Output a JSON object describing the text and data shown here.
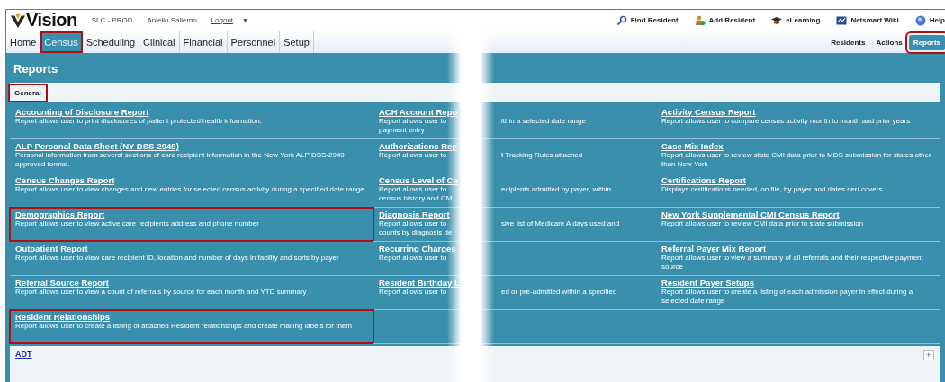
{
  "header": {
    "logo": "Vision",
    "environment": "SLC - PROD",
    "user": "Aniello Saliemo",
    "logout": "Logout",
    "menu_caret": "▼",
    "links": [
      {
        "kind": "search",
        "label": "Find Resident"
      },
      {
        "kind": "add",
        "label": "Add Resident"
      },
      {
        "kind": "cap",
        "label": "eLearning"
      },
      {
        "kind": "wiki",
        "label": "Netsmart Wiki"
      },
      {
        "kind": "help",
        "label": "Help"
      }
    ]
  },
  "tabs": [
    {
      "label": "Home",
      "selected": false,
      "highlighted": false
    },
    {
      "label": "Census",
      "selected": true,
      "highlighted": true
    },
    {
      "label": "Scheduling",
      "selected": false,
      "highlighted": false
    },
    {
      "label": "Clinical",
      "selected": false,
      "highlighted": false
    },
    {
      "label": "Financial",
      "selected": false,
      "highlighted": false
    },
    {
      "label": "Personnel",
      "selected": false,
      "highlighted": false
    },
    {
      "label": "Setup",
      "selected": false,
      "highlighted": false
    }
  ],
  "subtabs": [
    {
      "label": "Residents",
      "selected": false,
      "highlighted": false
    },
    {
      "label": "Actions",
      "selected": false,
      "highlighted": false
    },
    {
      "label": "Reports",
      "selected": true,
      "highlighted": true
    }
  ],
  "page_title": "Reports",
  "section": {
    "label": "General",
    "highlighted": true
  },
  "columns": [
    [
      {
        "title": "Accounting of Disclosure Report",
        "description": "Report allows user to print disclosures of patient protected health information.",
        "highlighted": false
      },
      {
        "title": "ALP Personal Data Sheet (NY DSS-2949)",
        "description": "Personal information from several sections of care recipient information in the New York ALP DSS-2949 approved format.",
        "highlighted": false
      },
      {
        "title": "Census Changes Report",
        "description": "Report allows user to view changes and new entries for selected census activity during a specified date range",
        "highlighted": false
      },
      {
        "title": "Demographics Report",
        "description": "Report allows user to view active care recipients address and phone number",
        "highlighted": true
      },
      {
        "title": "Outpatient Report",
        "description": "Report allows user to view care recipient ID, location and number of days in facility and sorts by payer",
        "highlighted": false
      },
      {
        "title": "Referral Source Report",
        "description": "Report allows user to view a count of referrals by source for each month and YTD summary",
        "highlighted": false
      },
      {
        "title": "Resident Relationships",
        "description": "Report allows user to create a listing of attached Resident relationships and create mailing labels for them",
        "highlighted": true
      }
    ],
    [
      {
        "title": "ACH Account Repo",
        "lines": [
          [
            "Report allows user to",
            "ithin a selected date range"
          ],
          [
            "payment entry"
          ]
        ],
        "highlighted": false
      },
      {
        "title": "Authorizations Rep",
        "lines": [
          [
            "Report allows user to",
            "t Tracking Rules attached"
          ]
        ],
        "highlighted": false
      },
      {
        "title": "Census Level of Ca",
        "lines": [
          [
            "Report allows user to",
            "ecipients admitted by payer, within"
          ],
          [
            "census history and CM"
          ]
        ],
        "highlighted": false
      },
      {
        "title": "Diagnosis Report",
        "lines": [
          [
            "Report allows user to",
            "sive list of Medicare A days used and"
          ],
          [
            "counts by diagnosis de"
          ]
        ],
        "highlighted": false
      },
      {
        "title": "Recurring Charges",
        "lines": [
          [
            "Report allows user to"
          ]
        ],
        "highlighted": false
      },
      {
        "title": "Resident Birthday L",
        "lines": [
          [
            "Report allows user to",
            "ed or pre-admitted within a specified"
          ]
        ],
        "highlighted": false
      }
    ],
    [
      {
        "title": "Activity Census Report",
        "description": "Report allows user to compare census activity month to month and prior years",
        "highlighted": false
      },
      {
        "title": "Case Mix Index",
        "description": "Report allows user to review state CMI data prior to MDS submission for states other than New York",
        "highlighted": false
      },
      {
        "title": "Certifications Report",
        "description": "Displays certifications needed, on file, by payer and dates cert covers",
        "highlighted": false
      },
      {
        "title": "New York Supplemental CMI Census Report",
        "description": "Report allows user to review CMI data prior to state submission",
        "highlighted": false
      },
      {
        "title": "Referral Payer Mix Report",
        "description": "Report allows user to view a summary of all referrals and their respective payment source",
        "highlighted": false
      },
      {
        "title": "Resident Payer Setups",
        "description": "Report allows user to create a listing of each admission payer in effect during a selected date range",
        "highlighted": false
      }
    ]
  ],
  "next_section": {
    "label": "ADT",
    "expand": "+"
  }
}
